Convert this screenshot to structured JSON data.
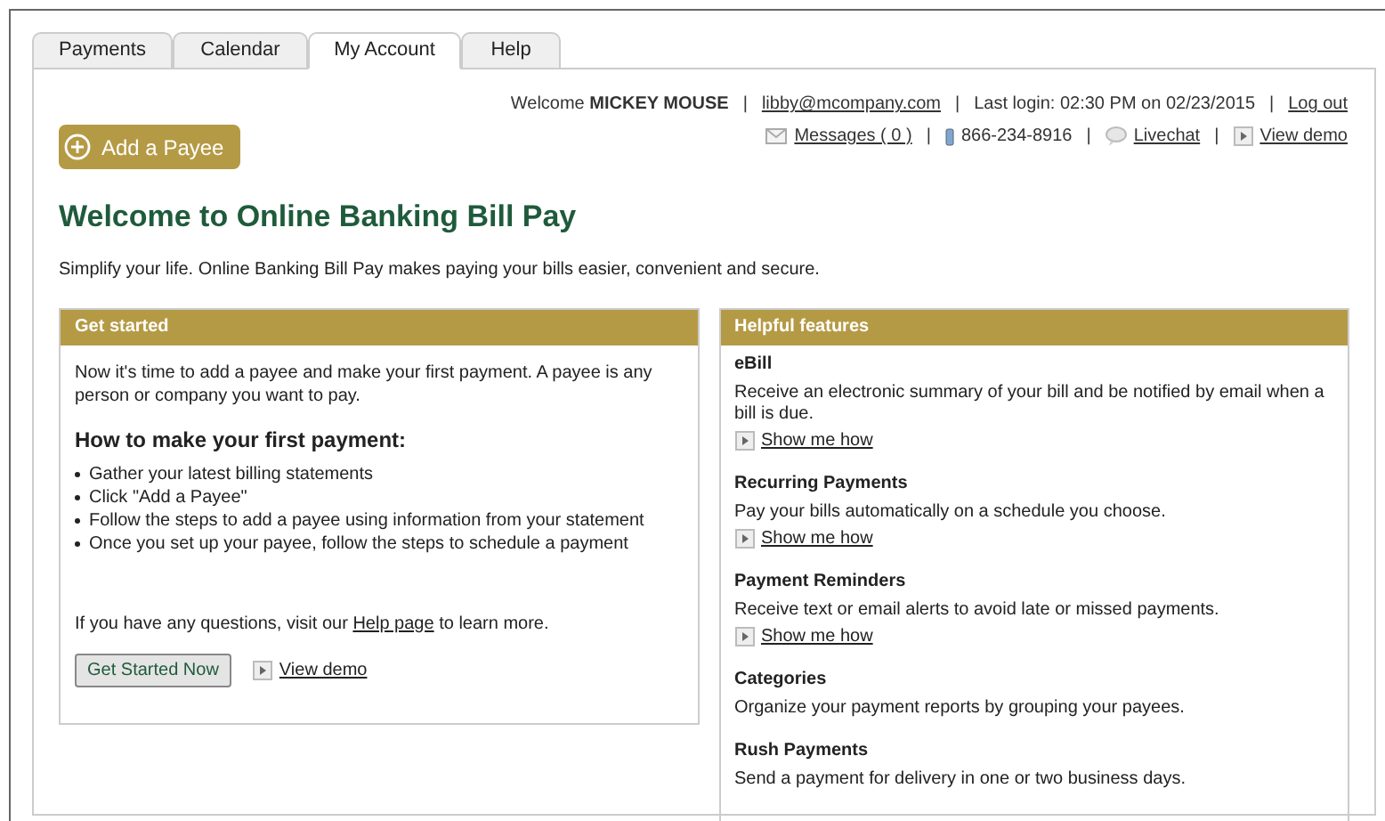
{
  "tabs": [
    {
      "label": "Payments",
      "selected": false
    },
    {
      "label": "Calendar",
      "selected": false
    },
    {
      "label": "My Account",
      "selected": true
    },
    {
      "label": "Help",
      "selected": false
    }
  ],
  "user_bar": {
    "line1": [
      {
        "kind": "text",
        "text": "Welcome **MICKEY MOUSE**"
      },
      {
        "kind": "separator",
        "text": "|"
      },
      {
        "kind": "link",
        "text": "libby@mcompany.com"
      },
      {
        "kind": "separator",
        "text": "|"
      },
      {
        "kind": "text",
        "text": "Last login: 02:30 PM on 02/23/2015"
      },
      {
        "kind": "separator",
        "text": "|"
      },
      {
        "kind": "link",
        "text": "Log out"
      }
    ],
    "line2": [
      {
        "kind": "mail_link",
        "text": "Messages ( 0 )"
      },
      {
        "kind": "separator",
        "text": "|"
      },
      {
        "kind": "phone",
        "text": "866-234-8916"
      },
      {
        "kind": "separator",
        "text": "|"
      },
      {
        "kind": "chat_link",
        "text": "Livechat"
      },
      {
        "kind": "separator",
        "text": "|"
      },
      {
        "kind": "demo_link",
        "text": "View demo"
      }
    ]
  },
  "add_payee_button": "Add a Payee",
  "title": "Welcome to Online Banking Bill Pay",
  "subtitle": "Simplify your life. Online Banking Bill Pay makes paying your bills easier, convenient and secure.",
  "get_started": {
    "header": "Get started",
    "intro": "Now it's time to add a payee and make your first payment. A payee is any person or company you want to pay.",
    "heading": "How to make your first payment:",
    "steps": [
      "Gather your latest billing statements",
      "Click \"Add a Payee\"",
      "Follow the steps to add a payee using information from your statement",
      "Once you set up your payee, follow the steps to schedule a payment"
    ],
    "help_text": {
      "before": "If you have any questions, visit our",
      "link": "Help page",
      "after": "to learn more."
    },
    "button": "Get Started Now",
    "demo_link": "View demo"
  },
  "helpful_features": {
    "header": "Helpful features",
    "items": [
      {
        "title": "eBill",
        "description": "Receive an electronic summary of your bill and be notified by email when a bill is due.",
        "link": "Show me how"
      },
      {
        "title": "Recurring Payments",
        "description": "Pay your bills automatically on a schedule you choose.",
        "link": "Show me how"
      },
      {
        "title": "Payment Reminders",
        "description": "Receive text or email alerts to avoid late or missed payments.",
        "link": "Show me how"
      },
      {
        "title": "Categories",
        "description": "Organize your payment reports by grouping your payees."
      },
      {
        "title": "Rush Payments",
        "description": "Send a payment for delivery in one or two business days."
      }
    ]
  }
}
